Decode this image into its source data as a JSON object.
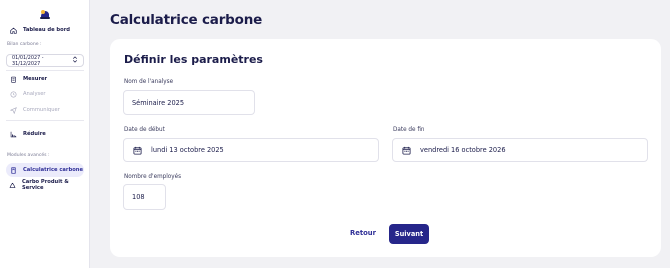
{
  "sidebar": {
    "nav": {
      "dashboard": "Tableau de bord",
      "measure": "Mesurer",
      "analyze": "Analyser",
      "communicate": "Communiquer",
      "reduce": "Réduire",
      "carbon_calc": "Calculatrice carbone",
      "carbo_product": "Carbo Produit & Service"
    },
    "bilan_label": "Bilan carbone :",
    "date_range": "01/01/2027 - 31/12/2027",
    "modules_label": "Modules avancés :"
  },
  "main": {
    "page_title": "Calculatrice carbone",
    "card_title": "Définir les paramètres",
    "fields": {
      "analysis_name": {
        "label": "Nom de l'analyse",
        "value": "Séminaire 2025"
      },
      "start_date": {
        "label": "Date de début",
        "value": "lundi 13 octobre 2025"
      },
      "end_date": {
        "label": "Date de fin",
        "value": "vendredi 16 octobre 2026"
      },
      "employees": {
        "label": "Nombre d'employés",
        "value": "108"
      }
    },
    "buttons": {
      "back": "Retour",
      "next": "Suivant"
    }
  },
  "colors": {
    "accent": "#26268a",
    "active_bg": "#ebebfb",
    "text": "#1b1c4a",
    "muted": "#a8a9bd"
  },
  "icons": [
    "logo-icon",
    "home-icon",
    "chevron-updown-icon",
    "clipboard-icon",
    "clock-icon",
    "send-icon",
    "chart-down-icon",
    "calculator-icon",
    "recycle-icon",
    "calendar-icon"
  ]
}
